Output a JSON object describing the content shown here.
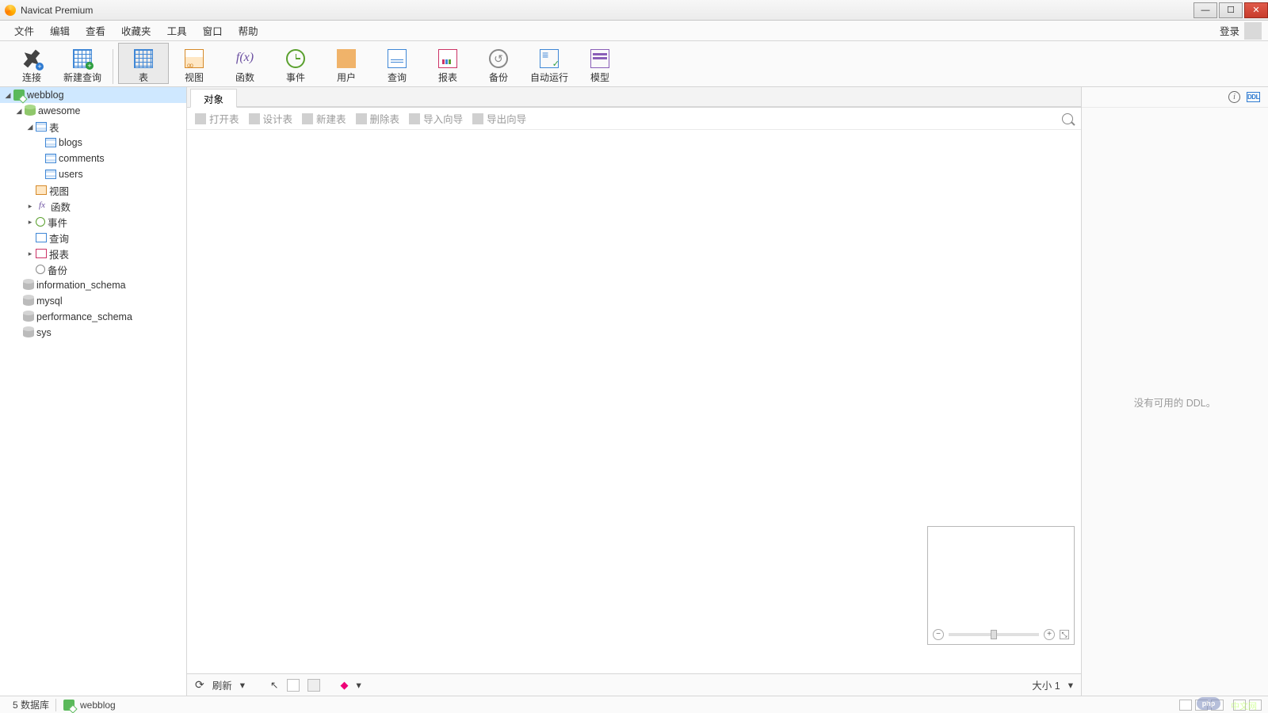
{
  "window": {
    "title": "Navicat Premium"
  },
  "menubar": {
    "items": [
      "文件",
      "编辑",
      "查看",
      "收藏夹",
      "工具",
      "窗口",
      "帮助"
    ],
    "login": "登录"
  },
  "toolbar": {
    "connect": "连接",
    "newquery": "新建查询",
    "table": "表",
    "view": "视图",
    "function": "函数",
    "event": "事件",
    "user": "用户",
    "query": "查询",
    "report": "报表",
    "backup": "备份",
    "autorun": "自动运行",
    "model": "模型"
  },
  "sidebar": {
    "connection": "webblog",
    "active_db": "awesome",
    "tables_label": "表",
    "tables": [
      "blogs",
      "comments",
      "users"
    ],
    "view_label": "视图",
    "function_label": "函数",
    "event_label": "事件",
    "query_label": "查询",
    "report_label": "报表",
    "backup_label": "备份",
    "other_dbs": [
      "information_schema",
      "mysql",
      "performance_schema",
      "sys"
    ]
  },
  "content": {
    "tab": "对象",
    "subtoolbar": {
      "open": "打开表",
      "design": "设计表",
      "new": "新建表",
      "delete": "删除表",
      "import": "导入向导",
      "export": "导出向导"
    },
    "bottom": {
      "refresh": "刷新",
      "size": "大小 1"
    }
  },
  "infopanel": {
    "empty": "没有可用的 DDL。"
  },
  "statusbar": {
    "left": "5 数据库",
    "connection": "webblog"
  },
  "watermark": {
    "php": "php",
    "site": "中文网"
  }
}
